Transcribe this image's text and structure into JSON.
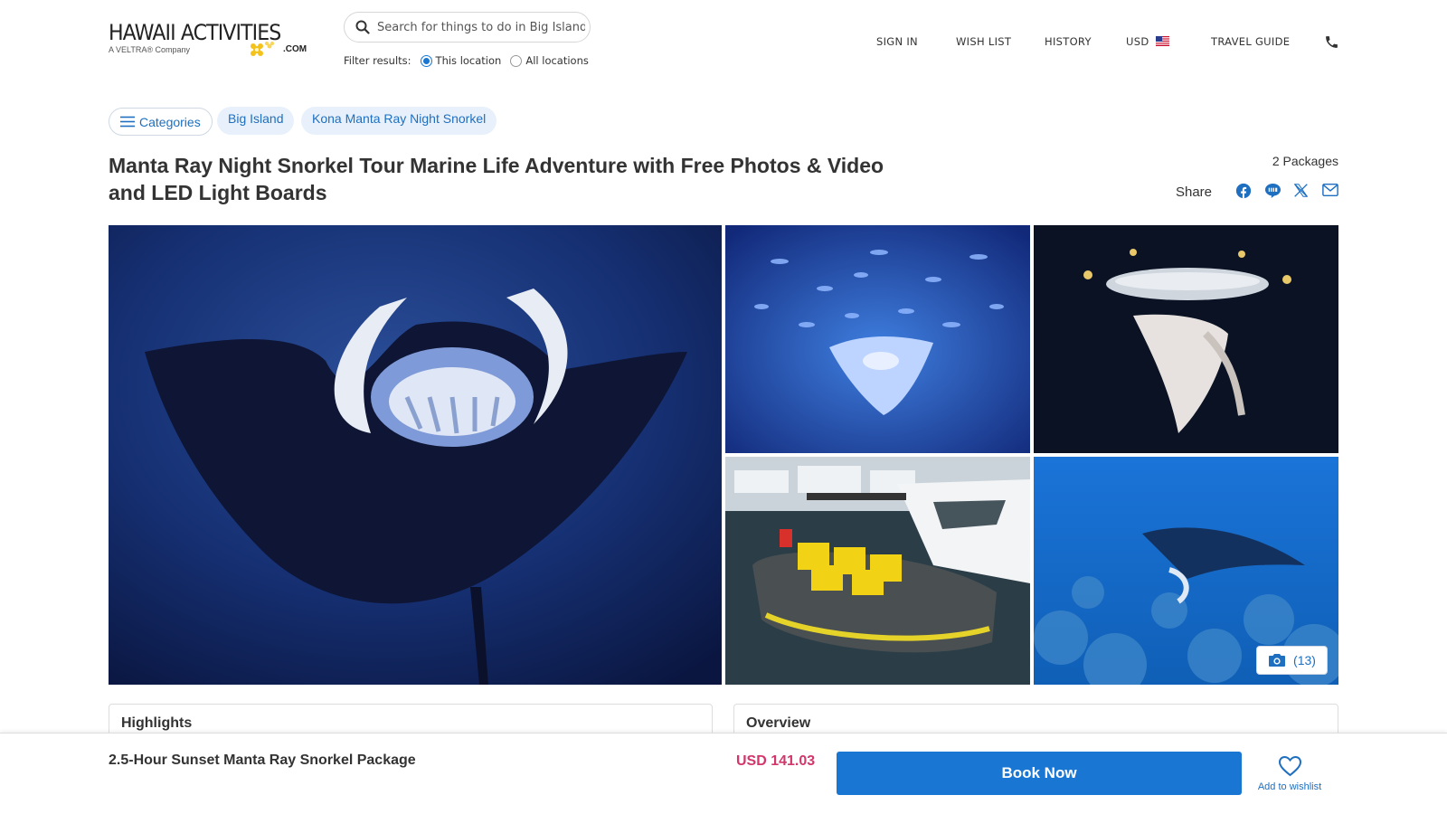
{
  "header": {
    "logo": {
      "main": "HAWAII ACTIVITIES",
      "tagline": "A VELTRA® Company",
      "suffix": ".COM"
    },
    "search": {
      "placeholder": "Search for things to do in Big Island"
    },
    "filter": {
      "label": "Filter results:",
      "options": [
        "This location",
        "All locations"
      ],
      "selected": "This location"
    },
    "nav": {
      "sign_in": "SIGN IN",
      "wish_list": "WISH LIST",
      "history": "HISTORY",
      "currency": "USD",
      "travel_guide": "TRAVEL GUIDE"
    },
    "icons": {
      "search": "search-icon",
      "flag": "us-flag-icon",
      "phone": "phone-icon"
    }
  },
  "breadcrumb": {
    "categories": "Categories",
    "items": [
      "Big Island",
      "Kona Manta Ray Night Snorkel"
    ]
  },
  "activity": {
    "title": "Manta Ray Night Snorkel Tour Marine Life Adventure with Free Photos & Video and LED Light Boards",
    "packages": "2 Packages",
    "share": {
      "label": "Share",
      "icons": [
        "facebook-icon",
        "line-icon",
        "x-icon",
        "email-icon"
      ]
    }
  },
  "gallery": {
    "photo_count": "(13)",
    "photos": [
      "manta-ray-close-up",
      "manta-ray-with-fish",
      "manta-ray-under-light-board",
      "snorkel-boat-in-harbor",
      "manta-ray-over-reef"
    ]
  },
  "sections": {
    "highlights": "Highlights",
    "overview": "Overview"
  },
  "booking": {
    "package_name": "2.5-Hour Sunset Manta Ray Snorkel Package",
    "price": "USD 141.03",
    "book_label": "Book Now",
    "wishlist_label": "Add to wishlist"
  },
  "colors": {
    "accent": "#1976d2",
    "price": "#d2366a",
    "link": "#1e6fc0"
  }
}
